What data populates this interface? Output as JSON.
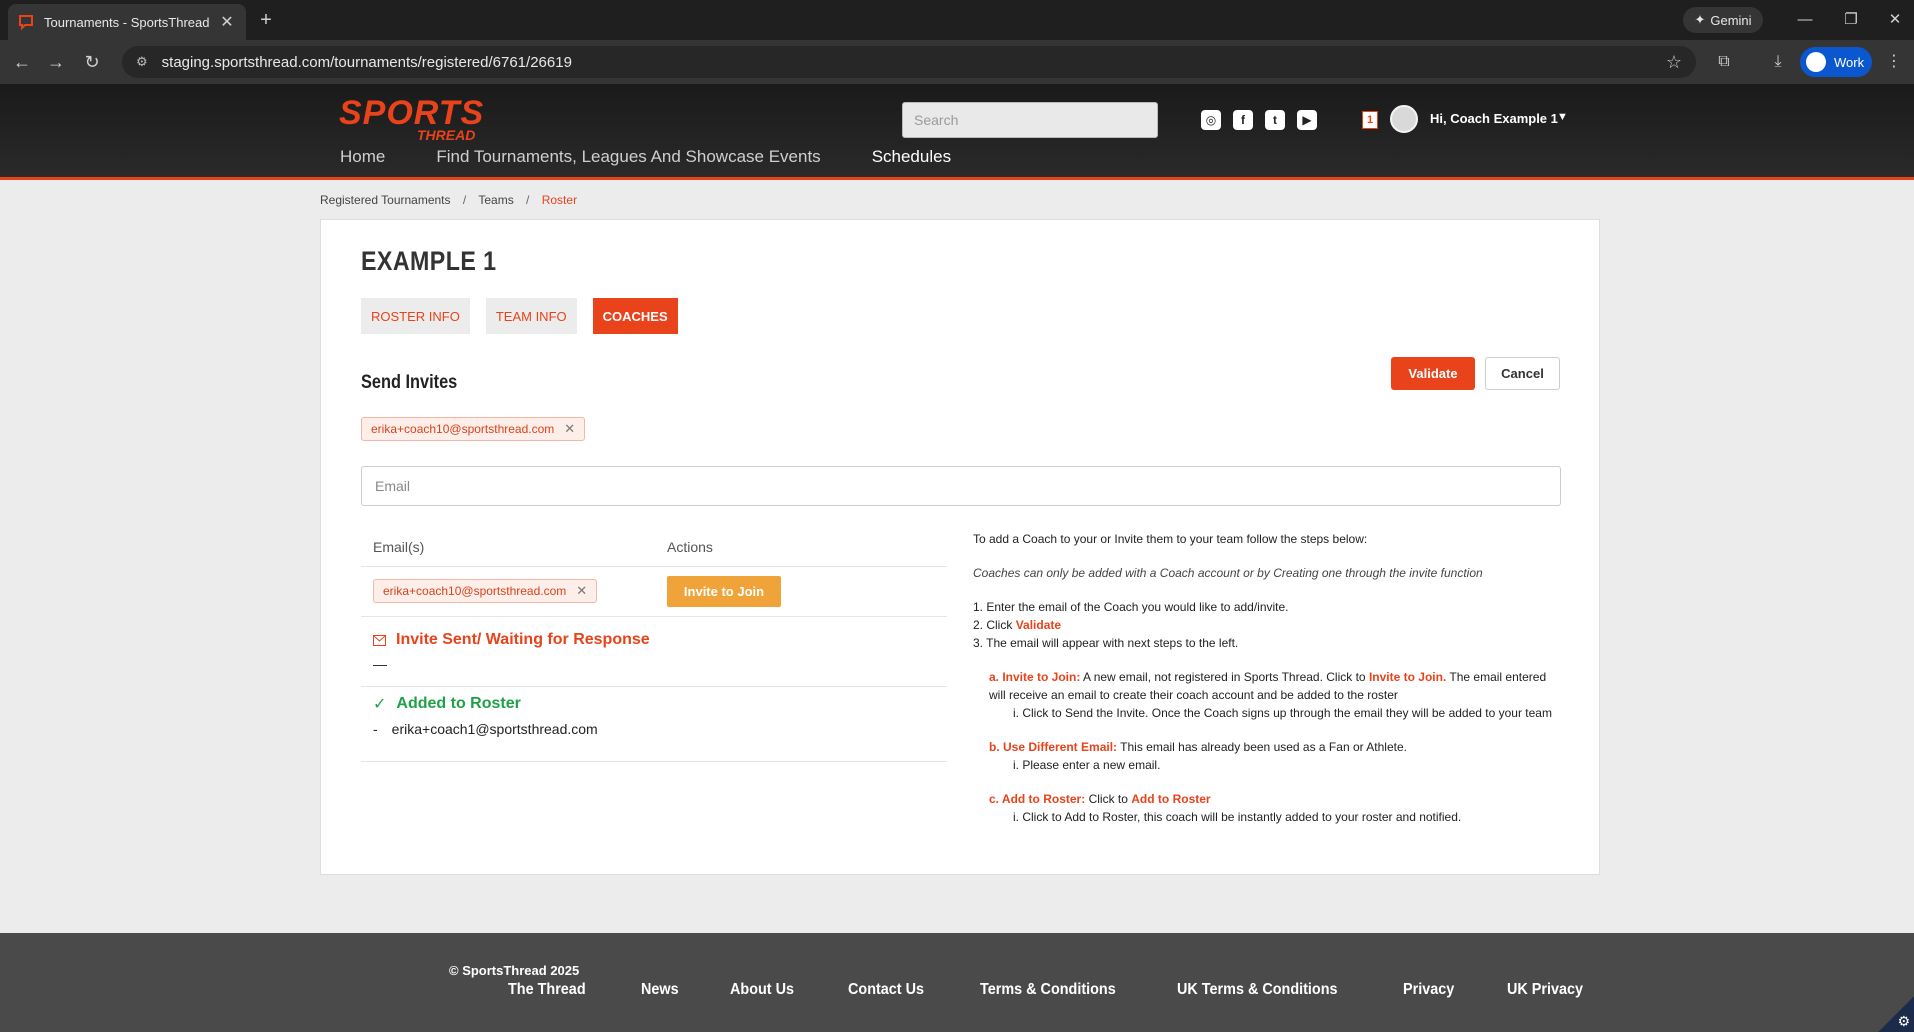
{
  "browser": {
    "tab_title": "Tournaments - SportsThread",
    "url": "staging.sportsthread.com/tournaments/registered/6761/26619",
    "gemini_label": "Gemini",
    "profile_label": "Work"
  },
  "site": {
    "logo_main": "SPORTS",
    "logo_sub": "THREAD",
    "nav": [
      "Home",
      "Find Tournaments, Leagues And Showcase Events",
      "Schedules"
    ],
    "search_placeholder": "Search",
    "notification_count": "1",
    "greeting": "Hi, Coach Example 1"
  },
  "breadcrumb": [
    "Registered Tournaments",
    "Teams",
    "Roster"
  ],
  "team": {
    "name": "EXAMPLE 1",
    "tabs": [
      "ROSTER INFO",
      "TEAM INFO",
      "COACHES"
    ],
    "active_tab": "COACHES"
  },
  "invites": {
    "title": "Send Invites",
    "validate_label": "Validate",
    "cancel_label": "Cancel",
    "chip_email": "erika+coach10@sportsthread.com",
    "email_placeholder": "Email",
    "col_emails": "Email(s)",
    "col_actions": "Actions",
    "row_email": "erika+coach10@sportsthread.com",
    "invite_button": "Invite to Join",
    "waiting_title": "Invite Sent/ Waiting for Response",
    "waiting_empty": "—",
    "added_title": "Added to Roster",
    "added_dash": "-",
    "added_email": "erika+coach1@sportsthread.com"
  },
  "help": {
    "intro": "To add a Coach to your or Invite them to your team follow the steps below:",
    "note": "Coaches can only be added with a Coach account or by Creating one through the invite function",
    "step1": "1. Enter the email of the Coach you would like to add/invite.",
    "step2_prefix": "2. Click ",
    "step2_hl": "Validate",
    "step3": "3. The email will appear with next steps to the left.",
    "a_hl": "a. Invite to Join:",
    "a_text": " A new email, not registered in Sports Thread. Click to ",
    "a_hl2": "Invite to Join.",
    "a_text2": " The email entered will receive an email to create their coach account and be added to the roster",
    "a_sub": "i. Click to Send the Invite. Once the Coach signs up through the email they will be added to your team",
    "b_hl": "b. Use Different Email:",
    "b_text": " This email has already been used as a Fan or Athlete.",
    "b_sub": "i. Please enter a new email.",
    "c_hl": "c. Add to Roster:",
    "c_text": " Click to ",
    "c_hl2": "Add to Roster",
    "c_sub": "i. Click to Add to Roster, this coach will be instantly added to your roster and notified."
  },
  "footer": {
    "copyright": "© SportsThread 2025",
    "links": [
      "The Thread",
      "News",
      "About Us",
      "Contact Us",
      "Terms & Conditions",
      "UK Terms & Conditions",
      "Privacy",
      "UK Privacy"
    ]
  },
  "colors": {
    "brand": "#e8431b",
    "invite_button": "#f0a338",
    "success": "#1fa247"
  }
}
